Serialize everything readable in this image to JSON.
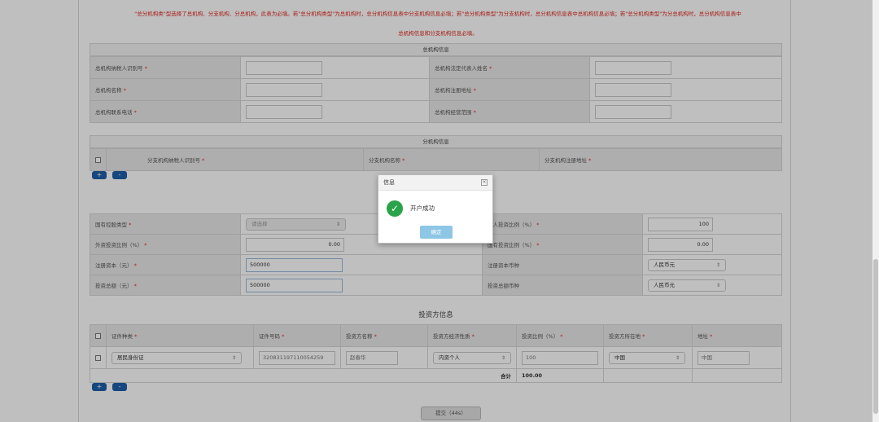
{
  "notice": {
    "line1": "\"总分机构类\"型选择了总机构、分支机构、分总机构，此表为必填。若\"总分机构类型\"为总机构时，总分机构信息表中分支机构信息必填；若\"总分机构类型\"为分支机构时，总分机构信息表中总机构信息必填；若\"总分机构类型\"为分总机构时，总分机构信息表中",
    "line2": "总机构信息和分支机构信息必填。"
  },
  "head_office": {
    "title": "总机构信息",
    "taxpayer_id": "总机构纳税人识别号",
    "legal_rep": "总机构法定代表人姓名",
    "name": "总机构名称",
    "reg_address": "总机构注册地址",
    "phone": "总机构联系电话",
    "business_scope": "总机构经营范围"
  },
  "branch": {
    "title": "分机构信息",
    "col_taxpayer_id": "分支机构纳税人识别号",
    "col_name": "分支机构名称",
    "col_address": "分支机构注册地址"
  },
  "required_mark": "*",
  "buttons": {
    "add": "+",
    "remove": "-",
    "submit": "提交（44s）"
  },
  "capital": {
    "state_holding_label": "国有控股类型",
    "state_holding_placeholder": "请选择",
    "natural_ratio_label": "然人投资比例（%）",
    "natural_ratio_value": "100",
    "foreign_ratio_label": "外资投资比例（%）",
    "foreign_ratio_value": "0.00",
    "state_ratio_label": "国有投资比例（%）",
    "state_ratio_value": "0.00",
    "reg_capital_label": "注册资本（元）",
    "reg_capital_value": "500000",
    "reg_currency_label": "注册资本币种",
    "reg_currency_value": "人民币元",
    "total_invest_label": "投资总额（元）",
    "total_invest_value": "500000",
    "invest_currency_label": "投资总额币种",
    "invest_currency_value": "人民币元"
  },
  "investors": {
    "title": "投资方信息",
    "columns": [
      "证件种类",
      "证件号码",
      "投资方名称",
      "投资方经济性质",
      "投资比例（%）",
      "投资方所在地",
      "地址"
    ],
    "row": {
      "id_type": "居民身份证",
      "id_number": "320831197110054259",
      "name": "赵春华",
      "nature": "内资个人",
      "ratio": "100",
      "location": "中国",
      "address": "中国"
    },
    "total_label": "合计",
    "total_value": "100.00"
  },
  "dialog": {
    "title": "信息",
    "close": "×",
    "message": "开户成功",
    "ok": "确定"
  },
  "colors": {
    "notice_red": "#e0261e",
    "button_blue": "#1e5fa8",
    "success_green": "#2aa34a",
    "ok_button": "#8ec6e6"
  }
}
